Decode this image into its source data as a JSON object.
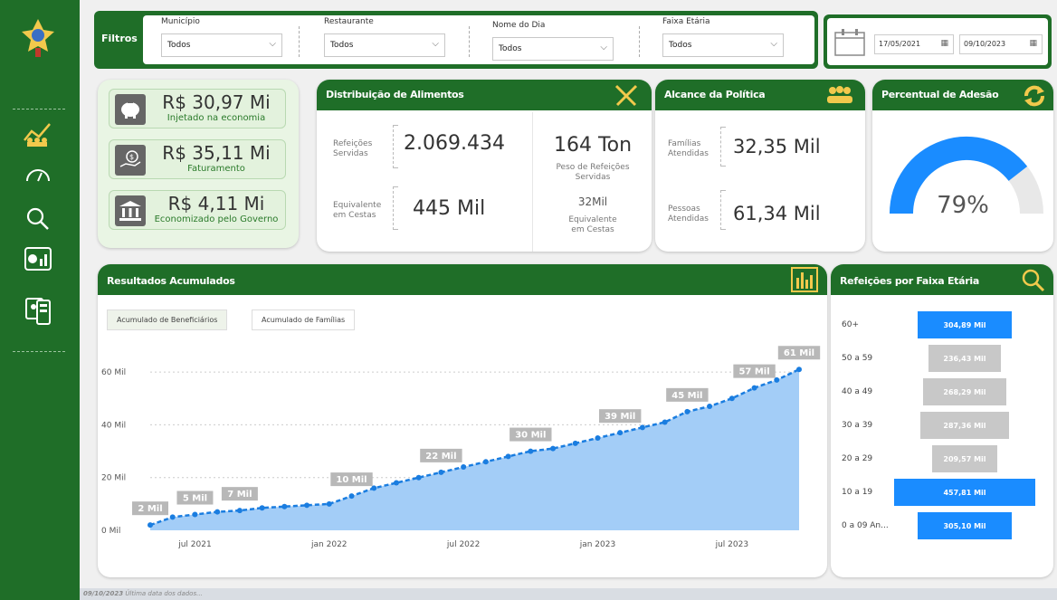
{
  "sidebar": {
    "icons": [
      "emblem-icon",
      "people-trend-icon",
      "gauge-icon",
      "search-icon",
      "chart-panel-icon",
      "device-report-icon"
    ]
  },
  "filters": {
    "title": "Filtros",
    "fields": [
      {
        "label": "Município",
        "value": "Todos"
      },
      {
        "label": "Restaurante",
        "value": "Todos"
      },
      {
        "label": "Nome do Dia",
        "value": "Todos"
      },
      {
        "label": "Faixa Etária",
        "value": "Todos"
      }
    ],
    "date_start": "17/05/2021",
    "date_end": "09/10/2023"
  },
  "kpis": [
    {
      "value": "R$ 30,97 Mi",
      "label": "Injetado na economia",
      "icon": "piggy-bank-icon"
    },
    {
      "value": "R$ 35,11 Mi",
      "label": "Faturamento",
      "icon": "money-hand-icon"
    },
    {
      "value": "R$ 4,11 Mi",
      "label": "Economizado pelo Governo",
      "icon": "government-building-icon"
    }
  ],
  "distribuicao": {
    "title": "Distribuição de Alimentos",
    "refeicoes_label": "Refeições Servidas",
    "refeicoes_value": "2.069.434",
    "cestas_label": "Equivalente em Cestas",
    "cestas_value": "445 Mil",
    "peso_value": "164 Ton",
    "peso_label": "Peso de Refeições Servidas",
    "cestas2_value": "32Mil",
    "cestas2_label": "Equivalente em Cestas"
  },
  "alcance": {
    "title": "Alcance da Política",
    "familias_label": "Famílias Atendidas",
    "familias_value": "32,35 Mil",
    "pessoas_label": "Pessoas Atendidas",
    "pessoas_value": "61,34 Mil"
  },
  "adesao": {
    "title": "Percentual de Adesão",
    "value_text": "79%",
    "value": 0.79,
    "fill_color": "#1a8cff",
    "track_color": "#e8e8e8"
  },
  "resultados": {
    "title": "Resultados Acumulados",
    "tab_active": "Acumulado de Beneficiários",
    "tab_other": "Acumulado de Famílias"
  },
  "faixa": {
    "title": "Refeições por Faixa Etária"
  },
  "footer": {
    "date": "09/10/2023",
    "text": "Última data dos dados..."
  },
  "chart_data": [
    {
      "type": "area",
      "title": "Resultados Acumulados",
      "x_ticks": [
        "jul 2021",
        "jan 2022",
        "jul 2022",
        "jan 2023",
        "jul 2023"
      ],
      "y_ticks": [
        "0 Mil",
        "20 Mil",
        "40 Mil",
        "60 Mil"
      ],
      "ylim": [
        0,
        70
      ],
      "x": [
        "2021-05",
        "2021-06",
        "2021-07",
        "2021-08",
        "2021-09",
        "2021-10",
        "2021-11",
        "2021-12",
        "2022-01",
        "2022-02",
        "2022-03",
        "2022-04",
        "2022-05",
        "2022-06",
        "2022-07",
        "2022-08",
        "2022-09",
        "2022-10",
        "2022-11",
        "2022-12",
        "2023-01",
        "2023-02",
        "2023-03",
        "2023-04",
        "2023-05",
        "2023-06",
        "2023-07",
        "2023-08",
        "2023-09",
        "2023-10"
      ],
      "values": [
        2,
        5,
        6,
        7,
        7.5,
        8.5,
        9,
        9.5,
        10,
        13,
        16,
        18,
        20,
        22,
        24,
        26,
        28,
        30,
        31,
        33,
        35,
        37,
        39,
        41,
        45,
        47,
        50,
        54,
        57,
        61
      ],
      "data_labels": [
        {
          "index": 0,
          "text": "2 Mil"
        },
        {
          "index": 2,
          "text": "5 Mil"
        },
        {
          "index": 4,
          "text": "7 Mil"
        },
        {
          "index": 9,
          "text": "10 Mil"
        },
        {
          "index": 13,
          "text": "22 Mil"
        },
        {
          "index": 17,
          "text": "30 Mil"
        },
        {
          "index": 21,
          "text": "39 Mil"
        },
        {
          "index": 24,
          "text": "45 Mil"
        },
        {
          "index": 27,
          "text": "57 Mil"
        },
        {
          "index": 29,
          "text": "61 Mil"
        }
      ],
      "line_color": "#1a7de0",
      "fill_color": "#a3cdf7",
      "grid": true
    },
    {
      "type": "bar",
      "orientation": "horizontal",
      "title": "Refeições por Faixa Etária",
      "categories": [
        "60+",
        "50 a 59",
        "40 a 49",
        "30 a 39",
        "20 a 29",
        "10 a 19",
        "0 a 09 An..."
      ],
      "values": [
        304.89,
        236.43,
        268.29,
        287.36,
        209.57,
        457.81,
        305.1
      ],
      "labels": [
        "304,89 Mil",
        "236,43 Mil",
        "268,29 Mil",
        "287,36 Mil",
        "209,57 Mil",
        "457,81 Mil",
        "305,10 Mil"
      ],
      "highlighted": [
        true,
        false,
        false,
        false,
        false,
        true,
        true
      ],
      "highlight_color": "#1a8cff",
      "base_color": "#c8c8c8"
    }
  ]
}
